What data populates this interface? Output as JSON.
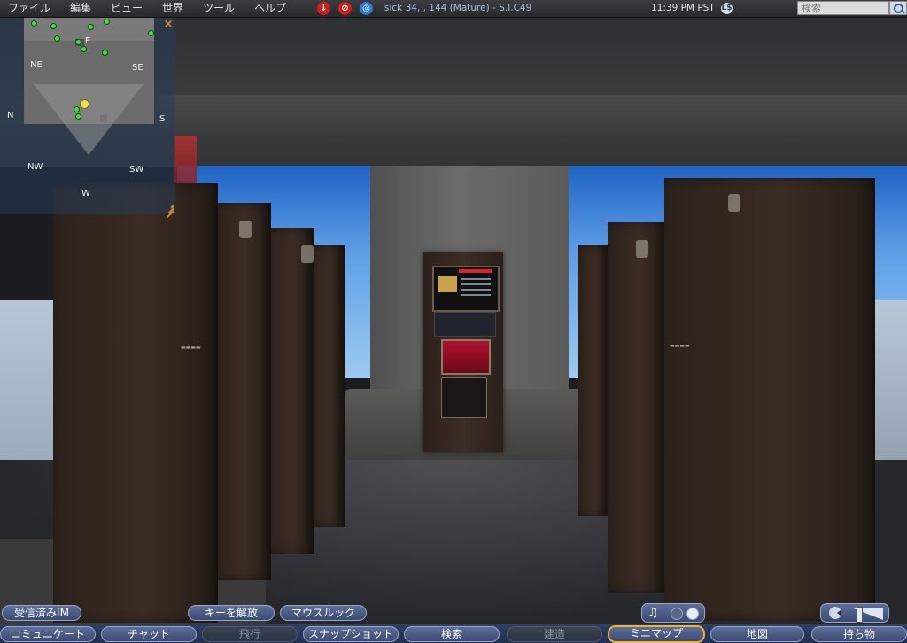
{
  "menu": {
    "items": [
      "ファイル",
      "編集",
      "ビュー",
      "世界",
      "ツール",
      "ヘルプ"
    ]
  },
  "status": {
    "icons": [
      "down-arrow-icon",
      "no-fly-icon",
      "voice-icon"
    ],
    "location": "sick 34,    , 144 (Mature) - S.I.C49",
    "time": "11:39 PM PST",
    "currency_symbol": "L$"
  },
  "search": {
    "placeholder": "検索"
  },
  "minimap": {
    "labels": {
      "n": "N",
      "ne": "NE",
      "e": "E",
      "se": "SE",
      "s": "S",
      "sw": "SW",
      "w": "W",
      "nw": "NW"
    },
    "close": "×"
  },
  "chat_row": {
    "im": "受信済みIM",
    "release_keys": "キーを解放",
    "mouselook": "マウスルック"
  },
  "media": {
    "note": "♫"
  },
  "toolbar": {
    "communicate": "コミュニケート",
    "chat": "チャット",
    "fly": "飛行",
    "snapshot": "スナップショット",
    "search": "検索",
    "build": "建造",
    "minimap": "ミニマップ",
    "map": "地図",
    "inventory": "持ち物"
  },
  "colors": {
    "accent": "#f0b030",
    "button": "#4b5c86",
    "menubar": "#2f3134"
  }
}
